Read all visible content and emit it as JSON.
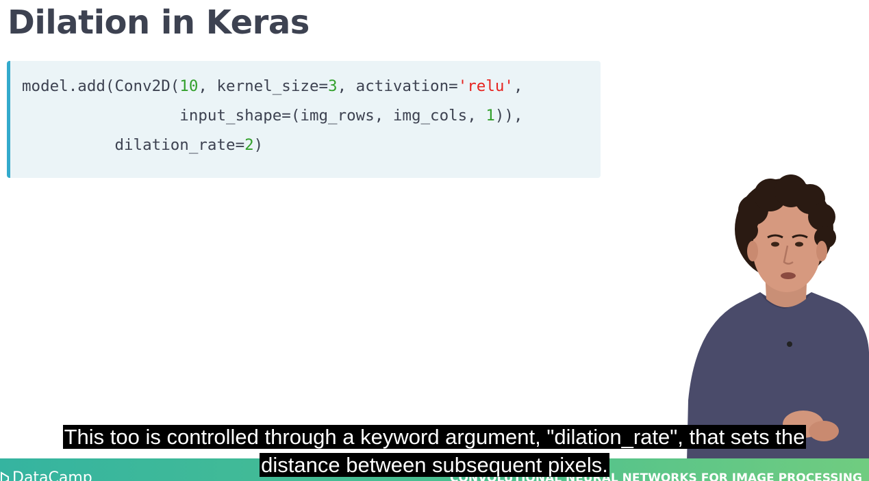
{
  "slide": {
    "title": "Dilation in Keras"
  },
  "code": {
    "line1": {
      "prefix": "model.add(Conv2D(",
      "filters": "10",
      "mid1": ", kernel_size=",
      "kernel": "3",
      "mid2": ", activation=",
      "activation": "'relu'",
      "suffix": ","
    },
    "line2": {
      "indent": "                 ",
      "prefix": "input_shape=(img_rows, img_cols, ",
      "channels": "1",
      "suffix": ")),"
    },
    "line3": {
      "indent": "          ",
      "prefix": "dilation_rate=",
      "rate": "2",
      "suffix": ")"
    }
  },
  "footer": {
    "brand": "DataCamp",
    "course": "CONVOLUTIONAL NEURAL NETWORKS FOR IMAGE PROCESSING"
  },
  "captions": {
    "line1": "This too is controlled through a keyword argument, \"dilation_rate\", that sets the",
    "line2": "distance between subsequent pixels."
  },
  "colors": {
    "title": "#3d4251",
    "code_bg": "#ebf4f7",
    "code_accent": "#33aacc",
    "number": "#33a02c",
    "string": "#e6231f",
    "footer_start": "#35b4a0",
    "footer_end": "#70cc80"
  }
}
